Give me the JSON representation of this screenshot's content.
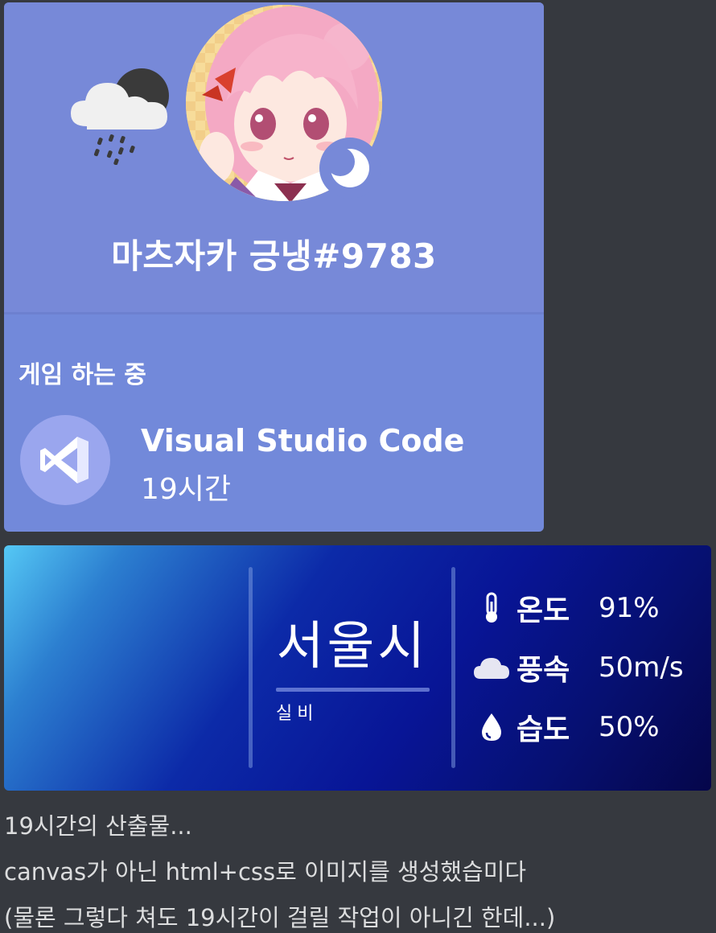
{
  "profile": {
    "username": "마츠자카 긍냉#9783",
    "status_icon": "moon-idle-icon",
    "activity_header": "게임 하는 중",
    "activity": {
      "app_name": "Visual Studio Code",
      "duration": "19시간",
      "icon": "vscode-icon"
    },
    "colors": {
      "card": "#7289da",
      "text": "#ffffff"
    }
  },
  "weather": {
    "city": "서울시",
    "condition": "실비",
    "icon": "rain-cloud-night-icon",
    "stats": [
      {
        "label": "온도",
        "value": "91%",
        "icon": "thermometer-icon"
      },
      {
        "label": "풍속",
        "value": "50m/s",
        "icon": "cloud-icon"
      },
      {
        "label": "습도",
        "value": "50%",
        "icon": "water-drop-icon"
      }
    ]
  },
  "message": {
    "lines": [
      "19시간의 산출물...",
      "canvas가 아닌 html+css로 이미지를 생성했습미다",
      "(물론 그렇다 쳐도 19시간이 걸릴 작업이 아니긴 한데...)"
    ]
  }
}
